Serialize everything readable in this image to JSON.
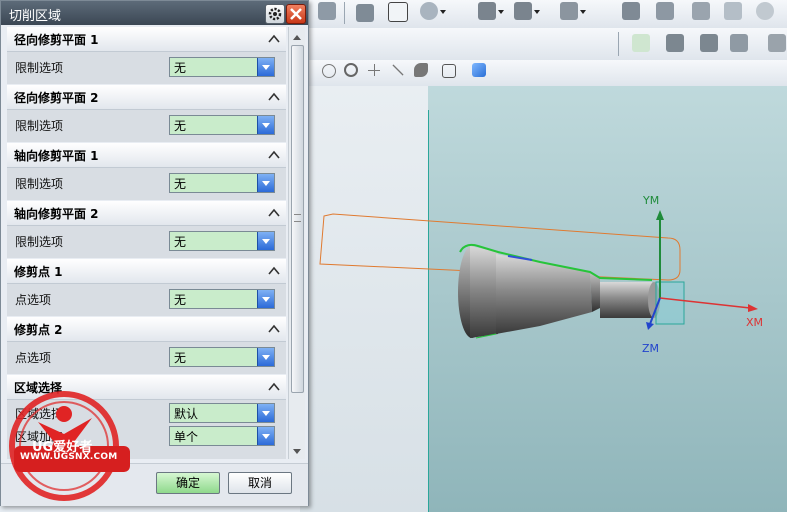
{
  "dialog": {
    "title": "切削区域",
    "sections": [
      {
        "title": "径向修剪平面 1",
        "row_label": "限制选项",
        "value": "无"
      },
      {
        "title": "径向修剪平面 2",
        "row_label": "限制选项",
        "value": "无"
      },
      {
        "title": "轴向修剪平面 1",
        "row_label": "限制选项",
        "value": "无"
      },
      {
        "title": "轴向修剪平面 2",
        "row_label": "限制选项",
        "value": "无"
      },
      {
        "title": "修剪点 1",
        "row_label": "点选项",
        "value": "无"
      },
      {
        "title": "修剪点 2",
        "row_label": "点选项",
        "value": "无"
      },
      {
        "title": "区域选择",
        "rows": [
          {
            "label": "区域选择",
            "value": "默认"
          },
          {
            "label": "区域加工",
            "value": "单个"
          }
        ]
      }
    ],
    "ok_label": "确定",
    "cancel_label": "取消"
  },
  "viewport": {
    "axis_y": "YM",
    "axis_x": "XM",
    "axis_z": "ZM"
  },
  "watermark": {
    "brand": "UG爱好者",
    "url": "WWW.UGSNX.COM"
  },
  "colors": {
    "accent_combo": "#c9eccb",
    "title_bar": "#3b4754",
    "ok_button": "#8fd98c",
    "close_button": "#c83818",
    "boundary_orange": "#e07a30",
    "axis_red": "#d33",
    "axis_green": "#1f8b3a",
    "axis_blue": "#2244cc"
  }
}
